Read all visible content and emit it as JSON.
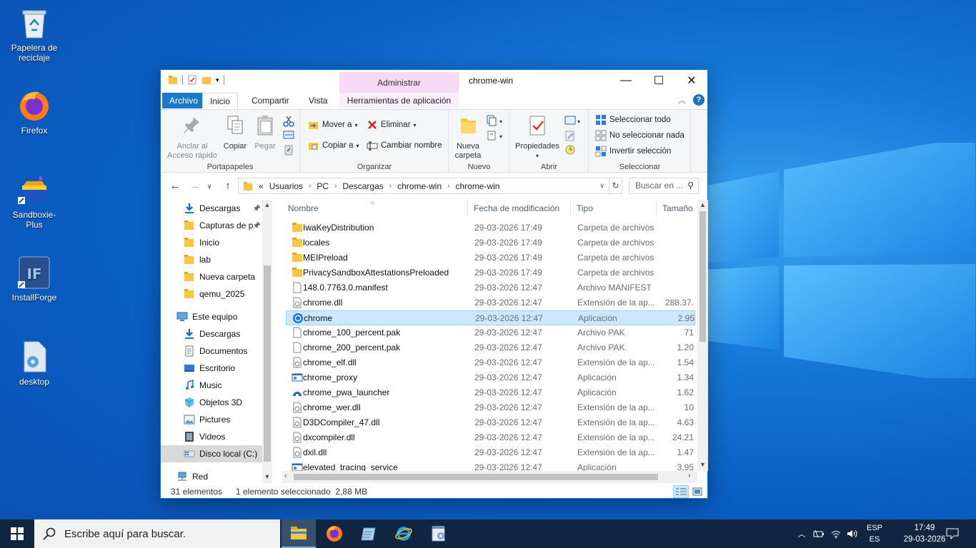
{
  "desktop": {
    "icons": [
      {
        "label": "Papelera de reciclaje",
        "icon": "recycle-bin-icon"
      },
      {
        "label": "Firefox",
        "icon": "firefox-icon"
      },
      {
        "label": "Sandboxie-Plus",
        "icon": "sandboxie-icon"
      },
      {
        "label": "InstallForge",
        "icon": "installforge-icon"
      },
      {
        "label": "desktop",
        "icon": "settings-file-icon"
      }
    ]
  },
  "window": {
    "title": "chrome-win",
    "context_header": "Administrar",
    "controls": {
      "minimize": "—",
      "maximize": "☐",
      "close": "✕"
    }
  },
  "tabs": {
    "file": "Archivo",
    "home": "Inicio",
    "share": "Compartir",
    "view": "Vista",
    "context": "Herramientas de aplicación"
  },
  "ribbon": {
    "clipboard": {
      "label": "Portapapeles",
      "pin": "Anclar al Acceso rápido",
      "pin_l1": "Anclar al",
      "pin_l2": "Acceso rápido",
      "copy": "Copiar",
      "paste": "Pegar"
    },
    "organize": {
      "label": "Organizar",
      "move": "Mover a",
      "copy_to": "Copiar a",
      "delete": "Eliminar",
      "rename": "Cambiar nombre"
    },
    "new": {
      "label": "Nuevo",
      "folder_l1": "Nueva",
      "folder_l2": "carpeta"
    },
    "open": {
      "label": "Abrir",
      "properties": "Propiedades"
    },
    "select": {
      "label": "Seleccionar",
      "all": "Seleccionar todo",
      "none": "No seleccionar nada",
      "invert": "Invertir selección"
    }
  },
  "address": {
    "prefix": "«",
    "crumbs": [
      "Usuarios",
      "PC",
      "Descargas",
      "chrome-win",
      "chrome-win"
    ],
    "search_placeholder": "Buscar en ..."
  },
  "nav_pane": {
    "items": [
      {
        "label": "Descargas",
        "icon": "download-arrow-icon",
        "pinned": true
      },
      {
        "label": "Capturas de p",
        "icon": "folder-icon",
        "pinned": true
      },
      {
        "label": "Inicio",
        "icon": "folder-icon"
      },
      {
        "label": "lab",
        "icon": "folder-icon"
      },
      {
        "label": "Nueva carpeta",
        "icon": "folder-icon"
      },
      {
        "label": "qemu_2025",
        "icon": "folder-icon"
      },
      {
        "label": "Este equipo",
        "icon": "computer-icon"
      },
      {
        "label": "Descargas",
        "icon": "download-arrow-icon"
      },
      {
        "label": "Documentos",
        "icon": "documents-icon"
      },
      {
        "label": "Escritorio",
        "icon": "desktop-folder-icon"
      },
      {
        "label": "Music",
        "icon": "music-icon"
      },
      {
        "label": "Objetos 3D",
        "icon": "3d-objects-icon"
      },
      {
        "label": "Pictures",
        "icon": "pictures-icon"
      },
      {
        "label": "Videos",
        "icon": "videos-icon"
      },
      {
        "label": "Disco local (C:)",
        "icon": "drive-icon"
      },
      {
        "label": "Red",
        "icon": "network-icon"
      }
    ]
  },
  "columns": [
    "Nombre",
    "Fecha de modificación",
    "Tipo",
    "Tamaño"
  ],
  "files": [
    {
      "name": "IwaKeyDistribution",
      "date": "29-03-2026 17:49",
      "type": "Carpeta de archivos",
      "size": "",
      "icon": "folder"
    },
    {
      "name": "locales",
      "date": "29-03-2026 17:49",
      "type": "Carpeta de archivos",
      "size": "",
      "icon": "folder"
    },
    {
      "name": "MEIPreload",
      "date": "29-03-2026 17:49",
      "type": "Carpeta de archivos",
      "size": "",
      "icon": "folder"
    },
    {
      "name": "PrivacySandboxAttestationsPreloaded",
      "date": "29-03-2026 17:49",
      "type": "Carpeta de archivos",
      "size": "",
      "icon": "folder"
    },
    {
      "name": "148.0.7763.0.manifest",
      "date": "29-03-2026 12:47",
      "type": "Archivo MANIFEST",
      "size": "",
      "icon": "file"
    },
    {
      "name": "chrome.dll",
      "date": "29-03-2026 12:47",
      "type": "Extensión de la ap...",
      "size": "288.37.",
      "icon": "dll"
    },
    {
      "name": "chrome",
      "date": "29-03-2026 12:47",
      "type": "Aplicación",
      "size": "2.95",
      "icon": "chrome",
      "selected": true
    },
    {
      "name": "chrome_100_percent.pak",
      "date": "29-03-2026 12:47",
      "type": "Archivo PAK",
      "size": "71",
      "icon": "file"
    },
    {
      "name": "chrome_200_percent.pak",
      "date": "29-03-2026 12:47",
      "type": "Archivo PAK",
      "size": "1.20",
      "icon": "file"
    },
    {
      "name": "chrome_elf.dll",
      "date": "29-03-2026 12:47",
      "type": "Extensión de la ap...",
      "size": "1.54",
      "icon": "dll"
    },
    {
      "name": "chrome_proxy",
      "date": "29-03-2026 12:47",
      "type": "Aplicación",
      "size": "1.34",
      "icon": "exe"
    },
    {
      "name": "chrome_pwa_launcher",
      "date": "29-03-2026 12:47",
      "type": "Aplicación",
      "size": "1.62",
      "icon": "pwa"
    },
    {
      "name": "chrome_wer.dll",
      "date": "29-03-2026 12:47",
      "type": "Extensión de la ap...",
      "size": "10",
      "icon": "dll"
    },
    {
      "name": "D3DCompiler_47.dll",
      "date": "29-03-2026 12:47",
      "type": "Extensión de la ap...",
      "size": "4.63",
      "icon": "dll"
    },
    {
      "name": "dxcompiler.dll",
      "date": "29-03-2026 12:47",
      "type": "Extensión de la ap...",
      "size": "24.21",
      "icon": "dll"
    },
    {
      "name": "dxil.dll",
      "date": "29-03-2026 12:47",
      "type": "Extensión de la ap...",
      "size": "1.47",
      "icon": "dll"
    },
    {
      "name": "elevated_tracing_service",
      "date": "29-03-2026 12:47",
      "type": "Aplicación",
      "size": "3.95",
      "icon": "exe"
    }
  ],
  "status": {
    "count": "31 elementos",
    "selection": "1 elemento seleccionado  2,88 MB"
  },
  "taskbar": {
    "search_placeholder": "Escribe aquí para buscar.",
    "apps": [
      "file-explorer-icon",
      "firefox-icon",
      "notepad-app-icon",
      "internet-explorer-icon",
      "installer-app-icon"
    ],
    "lang_top": "ESP",
    "lang_bottom": "ES",
    "time": "17:49",
    "date": "29-03-2026"
  },
  "colors": {
    "accent": "#1979ca",
    "selection": "#cce8ff",
    "context_tab": "#f5d9f5",
    "taskbar": "#10253f",
    "folder": "#f6c644"
  }
}
